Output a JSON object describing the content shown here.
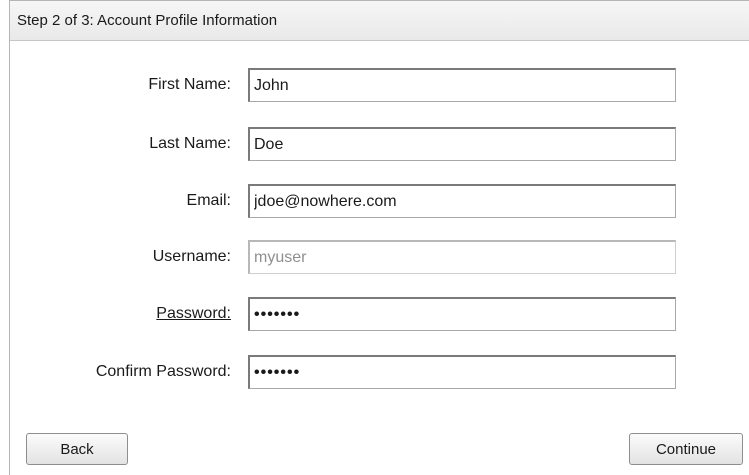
{
  "panel": {
    "title": "Step 2 of 3: Account Profile Information"
  },
  "form": {
    "fields": [
      {
        "label": "First Name:",
        "value": "John"
      },
      {
        "label": "Last Name:",
        "value": "Doe"
      },
      {
        "label": "Email:",
        "value": "jdoe@nowhere.com"
      },
      {
        "label": "Username:",
        "value": "myuser"
      },
      {
        "label": "Password:",
        "value": "•••••••"
      },
      {
        "label": "Confirm Password:",
        "value": "•••••••"
      }
    ]
  },
  "buttons": {
    "back_label": "Back",
    "continue_label": "Continue"
  }
}
